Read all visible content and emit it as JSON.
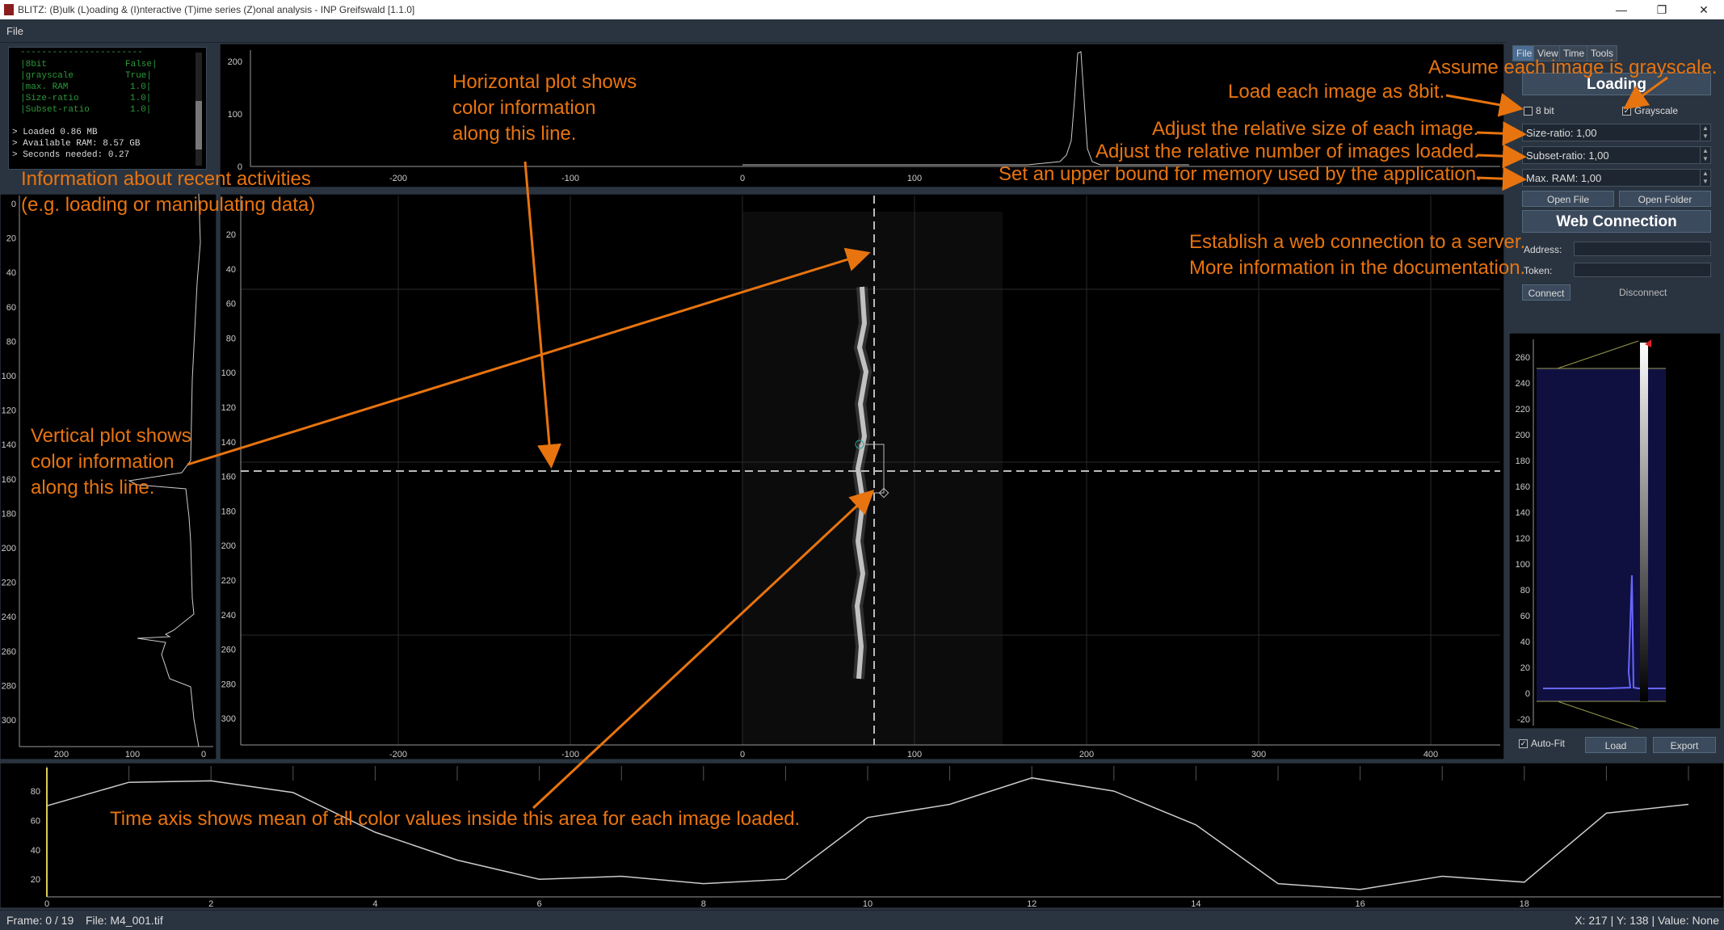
{
  "window": {
    "title": "BLITZ: (B)ulk (L)oading & (I)nteractive (T)ime series (Z)onal analysis - INP Greifswald [1.1.0]",
    "minimize": "—",
    "maximize": "❐",
    "close": "✕"
  },
  "menu": {
    "file": "File"
  },
  "log": {
    "settings": [
      {
        "key": "|8bit",
        "val": "False|"
      },
      {
        "key": "|grayscale",
        "val": "True|"
      },
      {
        "key": "|max. RAM",
        "val": "1.0|"
      },
      {
        "key": "|Size-ratio",
        "val": "1.0|"
      },
      {
        "key": "|Subset-ratio",
        "val": "1.0|"
      }
    ],
    "divider": "-----------------------",
    "lines": [
      "> Loaded 0.86 MB",
      "> Available RAM: 8.57 GB",
      "> Seconds needed: 0.27"
    ]
  },
  "h_profile": {
    "y_ticks": [
      "200",
      "100",
      "0"
    ],
    "x_ticks": [
      "-200",
      "-100",
      "0",
      "100"
    ]
  },
  "v_profile": {
    "y_ticks": [
      "0",
      "20",
      "40",
      "60",
      "80",
      "100",
      "120",
      "140",
      "160",
      "180",
      "200",
      "220",
      "240",
      "260",
      "280",
      "300"
    ],
    "x_ticks": [
      "200",
      "100",
      "0"
    ]
  },
  "image_view": {
    "y_ticks": [
      "20",
      "40",
      "60",
      "80",
      "100",
      "120",
      "140",
      "160",
      "180",
      "200",
      "220",
      "240",
      "260",
      "280",
      "300"
    ],
    "x_ticks": [
      "-200",
      "-100",
      "0",
      "100",
      "200",
      "300",
      "400"
    ]
  },
  "sidebar": {
    "tabs": [
      "File",
      "View",
      "Time",
      "Tools"
    ],
    "loading_title": "Loading",
    "checkbox_8bit": "8 bit",
    "checkbox_grayscale": "Grayscale",
    "grayscale_checked": "✓",
    "size_ratio": "Size-ratio: 1,00",
    "subset_ratio": "Subset-ratio: 1,00",
    "max_ram": "Max. RAM: 1,00",
    "open_file": "Open File",
    "open_folder": "Open Folder",
    "web_title": "Web Connection",
    "address_label": "Address:",
    "token_label": "Token:",
    "connect": "Connect",
    "disconnect": "Disconnect"
  },
  "histogram": {
    "y_ticks": [
      "260",
      "240",
      "220",
      "200",
      "180",
      "160",
      "140",
      "120",
      "100",
      "80",
      "60",
      "40",
      "20",
      "0",
      "-20"
    ],
    "autofit": "Auto-Fit",
    "autofit_checked": "✓",
    "load": "Load",
    "export": "Export"
  },
  "timeline": {
    "y_ticks": [
      "80",
      "60",
      "40",
      "20"
    ],
    "x_ticks": [
      "0",
      "2",
      "4",
      "6",
      "8",
      "10",
      "12",
      "14",
      "16",
      "18"
    ],
    "values": [
      70,
      86,
      87,
      79,
      52,
      33,
      20,
      22,
      17,
      20,
      62,
      71,
      89,
      80,
      57,
      17,
      13,
      22,
      18,
      65,
      71
    ],
    "ylim": [
      8,
      96
    ]
  },
  "annotations": {
    "horizontal": [
      "Horizontal plot shows",
      "color information",
      "along this line."
    ],
    "info": [
      "Information about recent activities",
      "(e.g. loading or manipulating data)"
    ],
    "vertical": [
      "Vertical plot shows",
      "color information",
      "along this line."
    ],
    "time_axis": "Time axis shows mean of all color values inside this area for each image loaded.",
    "grayscale": "Assume each image is grayscale.",
    "eightbit": "Load each image as 8bit.",
    "size": "Adjust the relative size of each image.",
    "subset": "Adjust the relative number of images loaded.",
    "ram": "Set an upper bound for memory used by the application.",
    "web": [
      "Establish a web connection to a server.",
      "More information in the documentation."
    ]
  },
  "status": {
    "frame": "Frame: 0 / 19",
    "file": "File: M4_001.tif",
    "coords": "X: 217 | Y: 138 | Value: None"
  },
  "colors": {
    "annotation": "#e8740f",
    "panel_bg": "#000000",
    "chrome": "#2a3440"
  }
}
